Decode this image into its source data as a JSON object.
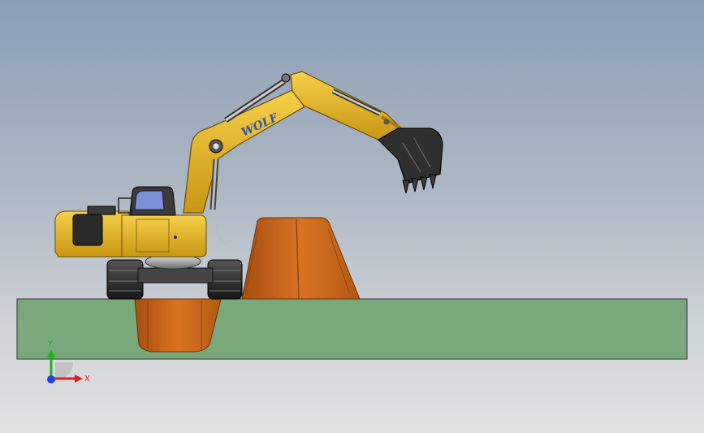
{
  "viewport": {
    "background_top": "#8c9eb4",
    "background_bottom": "#e2e2e2"
  },
  "model": {
    "boom_decal": "WOLF",
    "colors": {
      "machine_yellow": "#e8b92a",
      "track_dark": "#2a2a2a",
      "soil_orange": "#c8651a",
      "ground_green": "#79a87a",
      "decal_blue": "#2e55a8"
    }
  },
  "triad": {
    "x_label": "X",
    "y_label": "Y",
    "x_color": "#e02020",
    "y_color": "#20b020",
    "z_color": "#2040e0"
  }
}
